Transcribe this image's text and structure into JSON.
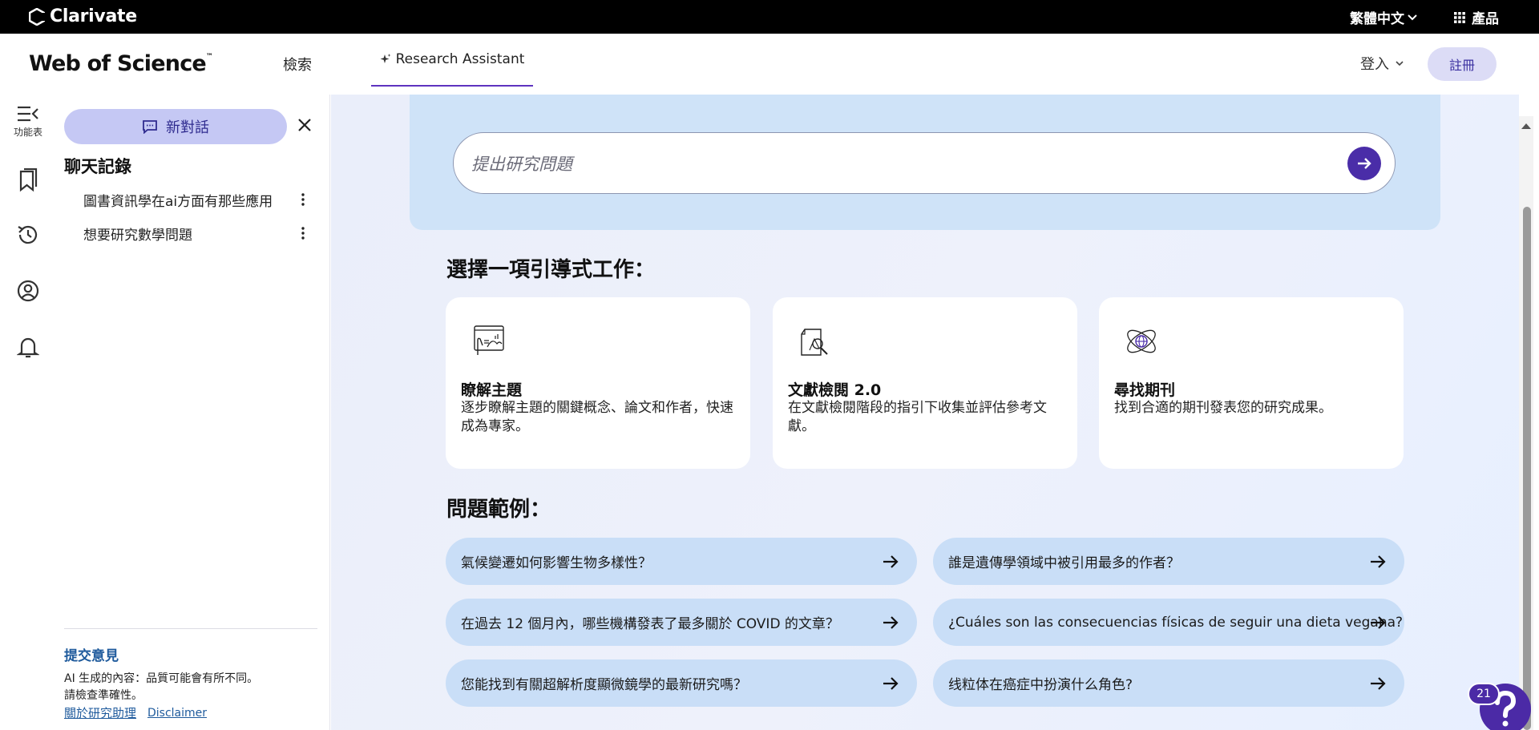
{
  "topbar": {
    "brand": "Clarivate",
    "language": "繁體中文",
    "products": "產品"
  },
  "header": {
    "logo": "Web of Science",
    "logo_tm": "™",
    "nav_search": "檢索",
    "nav_research_assistant": "Research Assistant",
    "login": "登入",
    "register": "註冊"
  },
  "rail": {
    "menu_label": "功能表",
    "icons": [
      "menu-collapse-icon",
      "bookmark-icon",
      "history-icon",
      "profile-icon",
      "bell-icon"
    ]
  },
  "panel": {
    "new_chat": "新對話",
    "history_title": "聊天記錄",
    "history": [
      "圖書資訊學在ai方面有那些應用",
      "想要研究數學問題"
    ],
    "feedback": "提交意見",
    "disclaimer_line1": "AI 生成的內容：品質可能會有所不同。",
    "disclaimer_line2": "請檢查準確性。",
    "about_link": "關於研究助理",
    "disclaimer_link": "Disclaimer"
  },
  "main": {
    "query_placeholder": "提出研究問題",
    "guided_title": "選擇一項引導式工作：",
    "cards": [
      {
        "title": "瞭解主題",
        "desc": "逐步瞭解主題的關鍵概念、論文和作者，快速成為專家。",
        "icon": "topic-insight-icon"
      },
      {
        "title": "文獻檢閱 2.0",
        "desc": "在文獻檢閱階段的指引下收集並評估參考文獻。",
        "icon": "literature-review-icon"
      },
      {
        "title": "尋找期刊",
        "desc": "找到合適的期刊發表您的研究成果。",
        "icon": "journal-finder-icon"
      }
    ],
    "examples_title": "問題範例：",
    "examples": [
      "氣候變遷如何影響生物多樣性？",
      "誰是遺傳學領域中被引用最多的作者？",
      "在過去 12 個月內，哪些機構發表了最多關於 COVID 的文章？",
      "¿Cuáles son las consecuencias físicas de seguir una dieta vegana?",
      "您能找到有關超解析度顯微鏡學的最新研究嗎？",
      "线粒体在癌症中扮演什么角色?"
    ]
  },
  "help": {
    "badge_count": "21"
  },
  "colors": {
    "accent_purple": "#4a2da8",
    "example_bg": "#c9def7",
    "new_chat_bg": "#c5c8f4",
    "link_blue": "#1e5a9c"
  }
}
